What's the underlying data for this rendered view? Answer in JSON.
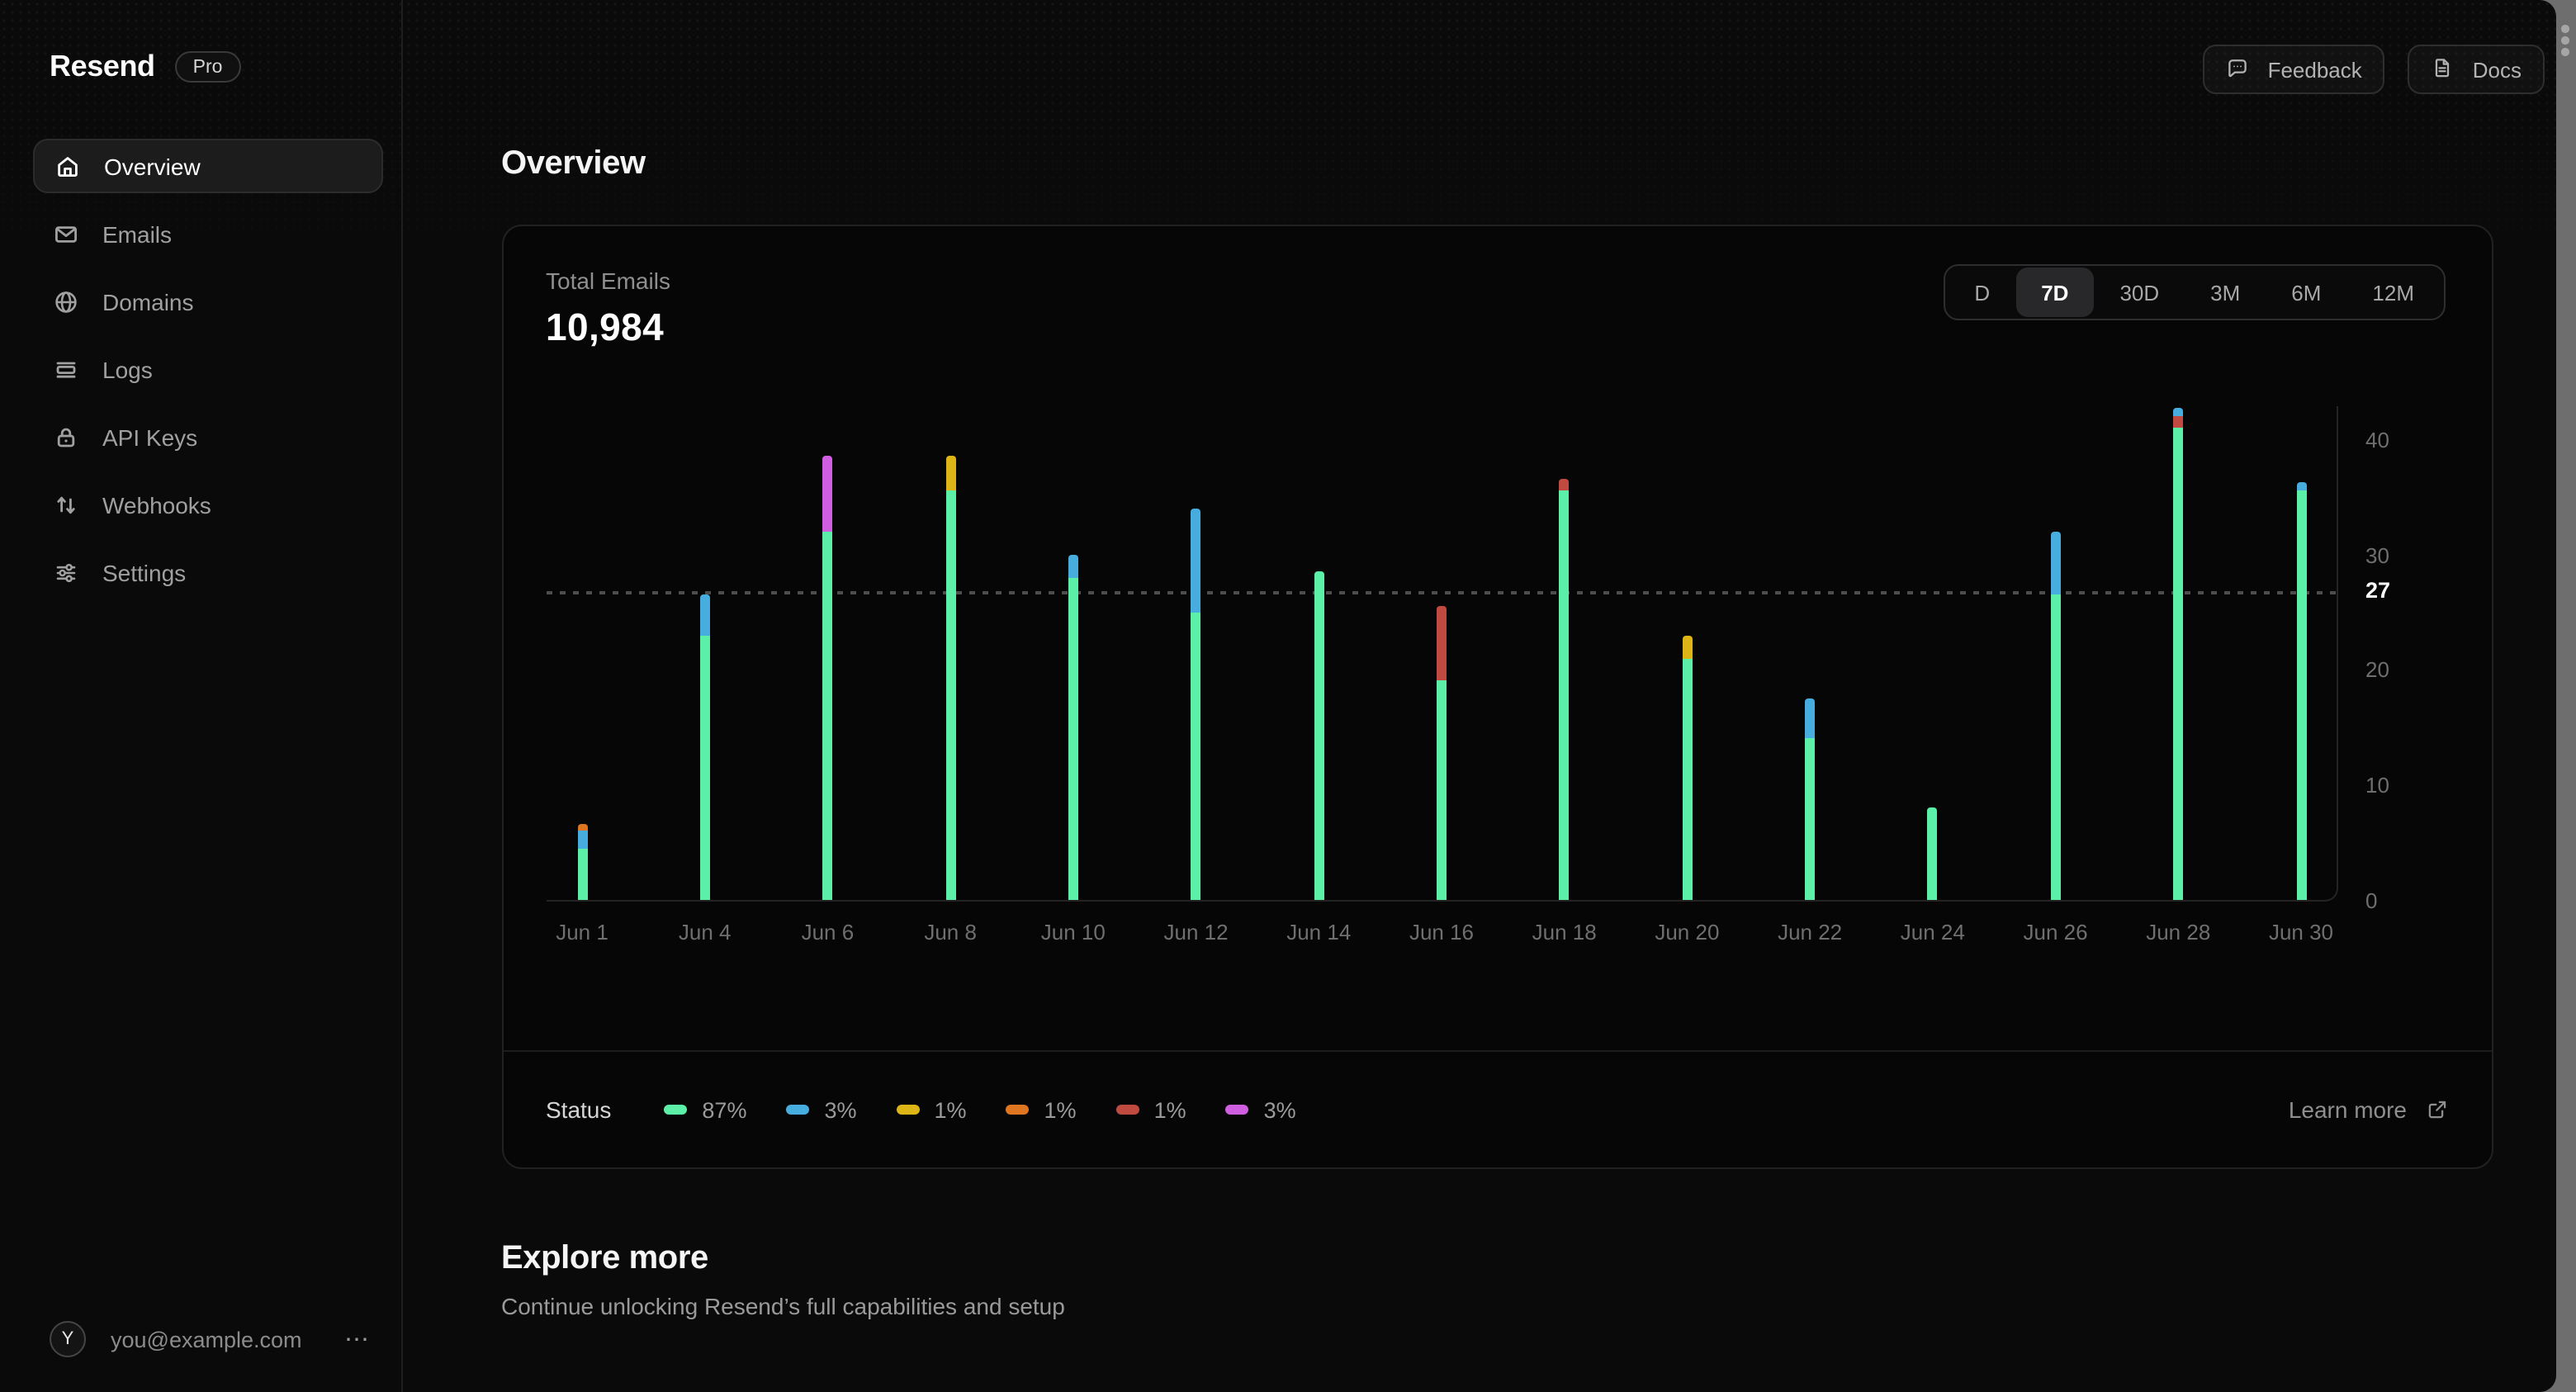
{
  "brand": {
    "name": "Resend",
    "plan_badge": "Pro"
  },
  "sidebar": {
    "items": [
      {
        "label": "Overview",
        "icon": "home",
        "active": true
      },
      {
        "label": "Emails",
        "icon": "mail",
        "active": false
      },
      {
        "label": "Domains",
        "icon": "globe",
        "active": false
      },
      {
        "label": "Logs",
        "icon": "logs",
        "active": false
      },
      {
        "label": "API Keys",
        "icon": "lock",
        "active": false
      },
      {
        "label": "Webhooks",
        "icon": "arrows-up-down",
        "active": false
      },
      {
        "label": "Settings",
        "icon": "sliders",
        "active": false
      }
    ],
    "user": {
      "avatar_initial": "Y",
      "email": "you@example.com",
      "menu": "⋯"
    }
  },
  "header": {
    "feedback_label": "Feedback",
    "docs_label": "Docs"
  },
  "page": {
    "title": "Overview"
  },
  "card": {
    "metric_label": "Total Emails",
    "metric_value": "10,984",
    "ranges": [
      {
        "label": "D",
        "selected": false
      },
      {
        "label": "7D",
        "selected": true
      },
      {
        "label": "30D",
        "selected": false
      },
      {
        "label": "3M",
        "selected": false
      },
      {
        "label": "6M",
        "selected": false
      },
      {
        "label": "12M",
        "selected": false
      }
    ],
    "footer": {
      "legend_title": "Status",
      "learn_more": "Learn more"
    }
  },
  "explore": {
    "title": "Explore more",
    "subtitle": "Continue unlocking Resend’s full capabilities and setup"
  },
  "chart_data": {
    "type": "bar",
    "stacked": true,
    "title": "Total Emails by status",
    "xlabel": "",
    "ylabel": "",
    "ylim": [
      0,
      43
    ],
    "y_ticks": [
      0,
      10,
      20,
      30,
      40
    ],
    "reference_line": {
      "value": 27,
      "label": "27"
    },
    "grid": false,
    "legend_position": "bottom",
    "legend": [
      {
        "key": "green",
        "color": "#5CEFA8",
        "percent": "87%",
        "textured": false
      },
      {
        "key": "blue",
        "color": "#47ADDE",
        "percent": "3%",
        "textured": false
      },
      {
        "key": "yellow",
        "color": "#DDB514",
        "percent": "1%",
        "textured": false
      },
      {
        "key": "orange",
        "color": "#DE7621",
        "percent": "1%",
        "textured": true
      },
      {
        "key": "red",
        "color": "#C14A40",
        "percent": "1%",
        "textured": false
      },
      {
        "key": "magenta",
        "color": "#CF5FE0",
        "percent": "3%",
        "textured": false
      }
    ],
    "bars": [
      {
        "label": "Jun 1",
        "segments": [
          {
            "key": "green",
            "value": 4.4
          },
          {
            "key": "blue",
            "value": 1.6
          },
          {
            "key": "orange",
            "value": 0.6
          }
        ]
      },
      {
        "label": "Jun 4",
        "segments": [
          {
            "key": "green",
            "value": 23
          },
          {
            "key": "blue",
            "value": 3.5
          }
        ]
      },
      {
        "label": "Jun 6",
        "segments": [
          {
            "key": "green",
            "value": 32
          },
          {
            "key": "magenta",
            "value": 6.5
          }
        ]
      },
      {
        "label": "Jun 8",
        "segments": [
          {
            "key": "green",
            "value": 35.5
          },
          {
            "key": "yellow",
            "value": 3
          }
        ]
      },
      {
        "label": "Jun 10",
        "segments": [
          {
            "key": "green",
            "value": 28
          },
          {
            "key": "blue",
            "value": 2
          }
        ]
      },
      {
        "label": "Jun 12",
        "segments": [
          {
            "key": "green",
            "value": 25
          },
          {
            "key": "blue",
            "value": 9
          }
        ]
      },
      {
        "label": "Jun 14",
        "segments": [
          {
            "key": "green",
            "value": 28.5
          }
        ]
      },
      {
        "label": "Jun 16",
        "segments": [
          {
            "key": "green",
            "value": 19
          },
          {
            "key": "red",
            "value": 6.5
          }
        ]
      },
      {
        "label": "Jun 18",
        "segments": [
          {
            "key": "green",
            "value": 35.5
          },
          {
            "key": "red",
            "value": 1
          }
        ]
      },
      {
        "label": "Jun 20",
        "segments": [
          {
            "key": "green",
            "value": 21
          },
          {
            "key": "yellow",
            "value": 2
          }
        ]
      },
      {
        "label": "Jun 22",
        "segments": [
          {
            "key": "green",
            "value": 14
          },
          {
            "key": "blue",
            "value": 3.5
          }
        ]
      },
      {
        "label": "Jun 24",
        "segments": [
          {
            "key": "green",
            "value": 8
          }
        ]
      },
      {
        "label": "Jun 26",
        "segments": [
          {
            "key": "green",
            "value": 26.5
          },
          {
            "key": "blue",
            "value": 5.5
          }
        ]
      },
      {
        "label": "Jun 28",
        "segments": [
          {
            "key": "green",
            "value": 41
          },
          {
            "key": "red",
            "value": 1
          },
          {
            "key": "blue",
            "value": 0.7
          }
        ]
      },
      {
        "label": "Jun 30",
        "segments": [
          {
            "key": "green",
            "value": 35.5
          },
          {
            "key": "blue",
            "value": 0.7
          }
        ]
      }
    ]
  }
}
